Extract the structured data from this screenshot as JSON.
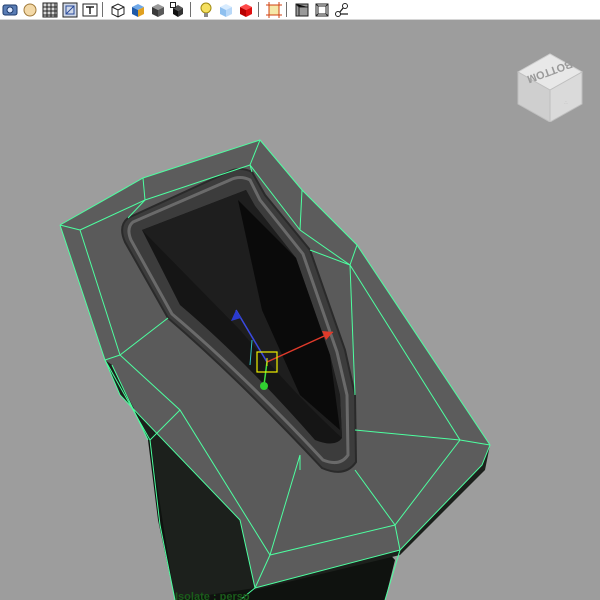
{
  "toolbar": {
    "buttons": [
      {
        "name": "camera-attributes-icon"
      },
      {
        "name": "image-plane-icon"
      },
      {
        "name": "grid-icon"
      },
      {
        "name": "film-gate-icon"
      },
      {
        "name": "resolution-gate-icon"
      },
      {
        "name": "wireframe-icon"
      },
      {
        "name": "smooth-shade-all-icon"
      },
      {
        "name": "flat-shade-icon"
      },
      {
        "name": "shade-selected-icon"
      },
      {
        "name": "use-all-lights-icon"
      },
      {
        "name": "xray-icon"
      },
      {
        "name": "textured-icon"
      },
      {
        "name": "isolate-select-icon"
      },
      {
        "name": "xray-joints-icon"
      },
      {
        "name": "backface-culling-icon"
      },
      {
        "name": "bounding-box-icon"
      },
      {
        "name": "display-joints-icon"
      }
    ]
  },
  "viewport": {
    "background_color": "#9d9d9d",
    "wireframe_color": "#4dffa0",
    "viewcube_face_label": "BOTTOM",
    "camera_label": "Isolate : persp"
  }
}
